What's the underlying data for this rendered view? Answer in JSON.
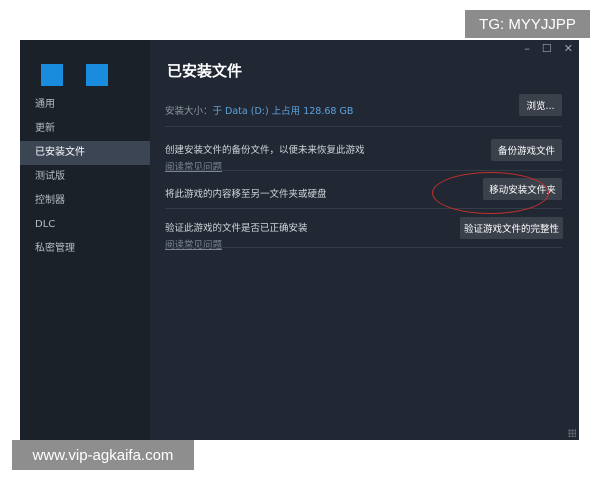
{
  "watermarks": {
    "top": "TG: MYYJJPP",
    "bottom": "www.vip-agkaifa.com"
  },
  "window_controls": {
    "minimize": "–",
    "maximize": "☐",
    "close": "✕"
  },
  "sidebar": {
    "items": [
      {
        "label": "通用",
        "active": false
      },
      {
        "label": "更新",
        "active": false
      },
      {
        "label": "已安装文件",
        "active": true
      },
      {
        "label": "测试版",
        "active": false
      },
      {
        "label": "控制器",
        "active": false
      },
      {
        "label": "DLC",
        "active": false
      },
      {
        "label": "私密管理",
        "active": false
      }
    ]
  },
  "main": {
    "title": "已安装文件",
    "install_size_label": "安装大小：",
    "install_size_value": "于 Data (D:) 上占用 128.68 GB",
    "browse_button": "浏览...",
    "backup_text": "创建安装文件的备份文件，以便未来恢复此游戏",
    "backup_link": "阅读常见问题",
    "backup_button": "备份游戏文件",
    "move_text": "将此游戏的内容移至另一文件夹或硬盘",
    "move_button": "移动安装文件夹",
    "verify_text": "验证此游戏的文件是否已正确安装",
    "verify_link": "阅读常见问题",
    "verify_button": "验证游戏文件的完整性"
  },
  "colors": {
    "sidebar_bg": "#1b2128",
    "main_bg": "#212833",
    "accent": "#5ba3e0",
    "highlight_ring": "#c0302c",
    "logo": "#1a8cde"
  }
}
